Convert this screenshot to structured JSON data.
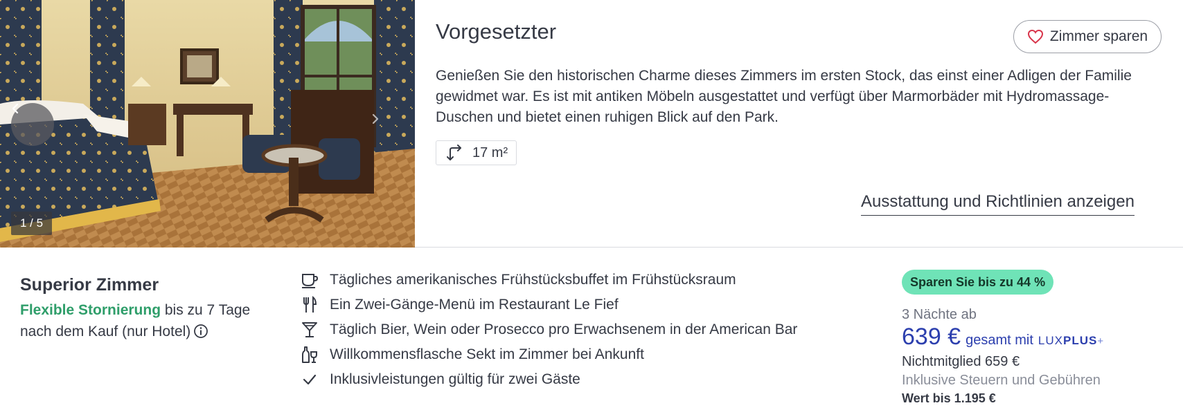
{
  "room": {
    "title": "Vorgesetzter",
    "save_label": "Zimmer sparen",
    "description": "Genießen Sie den historischen Charme dieses Zimmers im ersten Stock, das einst einer Adligen der Familie gewidmet war. Es ist mit antiken Möbeln ausgestattet und verfügt über Marmorbäder mit Hydromassage-Duschen und bietet einen ruhigen Blick auf den Park.",
    "size": "17 m²",
    "policies_link": "Ausstattung und Richtlinien anzeigen"
  },
  "gallery": {
    "counter": "1 / 5",
    "current": 1,
    "total": 5
  },
  "package": {
    "name": "Superior Zimmer",
    "cancel_highlight": "Flexible Stornierung",
    "cancel_rest": " bis zu 7 Tage nach dem Kauf (nur Hotel)"
  },
  "inclusions": [
    {
      "icon": "coffee-cup-icon",
      "text": "Tägliches amerikanisches Frühstücksbuffet im Frühstücksraum"
    },
    {
      "icon": "fork-knife-icon",
      "text": "Ein Zwei-Gänge-Menü im Restaurant Le Fief"
    },
    {
      "icon": "cocktail-glass-icon",
      "text": "Täglich Bier, Wein oder Prosecco pro Erwachsenem in der American Bar"
    },
    {
      "icon": "bottle-glass-icon",
      "text": "Willkommensflasche Sekt im Zimmer bei Ankunft"
    },
    {
      "icon": "checkmark-icon",
      "text": "Inklusivleistungen gültig für zwei Gäste"
    }
  ],
  "pricing": {
    "save_badge": "Sparen Sie bis zu 44 %",
    "nights": "3 Nächte ab",
    "price": "639 €",
    "total_label": "gesamt mit",
    "brand_lux": "LUX",
    "brand_plus": "PLUS",
    "brand_plus_sign": "+",
    "nonmember": "Nichtmitglied 659 €",
    "taxes": "Inklusive Steuern und Gebühren",
    "worth": "Wert bis 1.195 €"
  },
  "colors": {
    "text": "#363a45",
    "accent_green": "#2f9e6a",
    "badge_green": "#6fe3b7",
    "price_blue": "#2c3fae",
    "heart_red": "#d8344a"
  }
}
